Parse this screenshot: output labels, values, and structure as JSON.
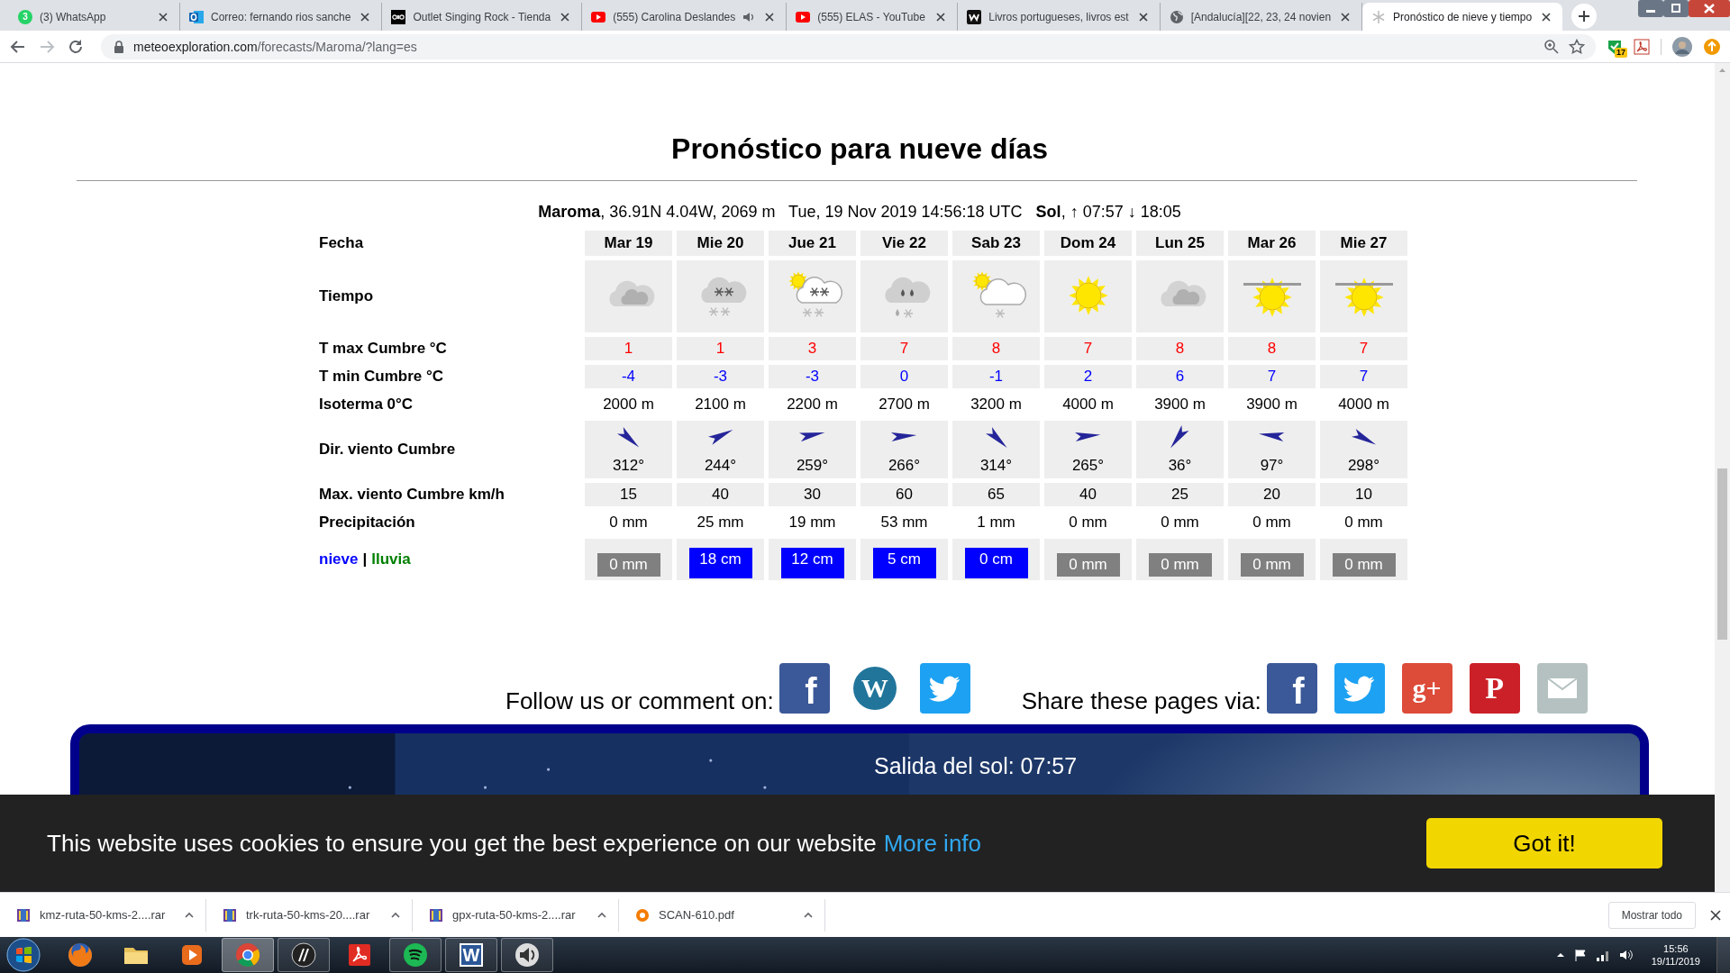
{
  "browser": {
    "tabs": [
      {
        "title": "(3) WhatsApp",
        "kind": "whatsapp",
        "glyph": "3",
        "selected": false,
        "audio": false
      },
      {
        "title": "Correo: fernando rios sanche",
        "kind": "outlook",
        "selected": false,
        "audio": false
      },
      {
        "title": "Outlet Singing Rock - Tienda",
        "kind": "dark-square",
        "selected": false,
        "audio": false
      },
      {
        "title": "(555) Carolina Deslandes",
        "kind": "youtube",
        "selected": false,
        "audio": true
      },
      {
        "title": "(555) ELAS - YouTube",
        "kind": "youtube",
        "selected": false,
        "audio": false
      },
      {
        "title": "Livros portugueses, livros est",
        "kind": "w-square",
        "selected": false,
        "audio": false
      },
      {
        "title": "[Andalucía][22, 23, 24 novien",
        "kind": "globe",
        "selected": false,
        "audio": false
      },
      {
        "title": "Pronóstico de nieve y tiempo",
        "kind": "snowflake",
        "selected": true,
        "audio": false
      }
    ],
    "url_host": "meteoexploration.com",
    "url_path": "/forecasts/Maroma/?lang=es",
    "extension_badge": "17"
  },
  "forecast": {
    "title": "Pronóstico para nueve días",
    "info": "**Maroma**, 36.91N 4.04W, 2069 m   Tue, 19 Nov 2019 14:56:18 UTC   **Sol**, ↑ 07:57 ↓ 18:05",
    "row_labels": [
      "Fecha",
      "Tiempo",
      "T max Cumbre °C",
      "T min Cumbre °C",
      "Isoterma 0°C",
      "Dir. viento Cumbre",
      "Max. viento Cumbre km/h",
      "Precipitación"
    ],
    "snow_label": "nieve",
    "separator": "|",
    "rain_label": "lluvia",
    "days": [
      {
        "date": "Mar 19",
        "kind": "cloud",
        "tmax": "1",
        "tmin": "-4",
        "isotherm": "2000 m",
        "wind_dir": "312°",
        "wind_max": "15",
        "precip": "0 mm",
        "snow": {
          "kind": "none",
          "text": "0 mm"
        }
      },
      {
        "date": "Mie 20",
        "kind": "snow-cloud",
        "tmax": "1",
        "tmin": "-3",
        "isotherm": "2100 m",
        "wind_dir": "244°",
        "wind_max": "40",
        "precip": "25 mm",
        "snow": {
          "kind": "snow",
          "text": "18 cm"
        }
      },
      {
        "date": "Jue 21",
        "kind": "sun-snow-cloud",
        "tmax": "3",
        "tmin": "-3",
        "isotherm": "2200 m",
        "wind_dir": "259°",
        "wind_max": "30",
        "precip": "19 mm",
        "snow": {
          "kind": "snow",
          "text": "12 cm"
        }
      },
      {
        "date": "Vie 22",
        "kind": "rain-snow-cloud",
        "tmax": "7",
        "tmin": "0",
        "isotherm": "2700 m",
        "wind_dir": "266°",
        "wind_max": "60",
        "precip": "53 mm",
        "snow": {
          "kind": "snow",
          "text": "5 cm"
        }
      },
      {
        "date": "Sab 23",
        "kind": "sun-cloud-snow",
        "tmax": "8",
        "tmin": "-1",
        "isotherm": "3200 m",
        "wind_dir": "314°",
        "wind_max": "65",
        "precip": "1 mm",
        "snow": {
          "kind": "snow",
          "text": "0 cm"
        }
      },
      {
        "date": "Dom 24",
        "kind": "sun",
        "tmax": "7",
        "tmin": "2",
        "isotherm": "4000 m",
        "wind_dir": "265°",
        "wind_max": "40",
        "precip": "0 mm",
        "snow": {
          "kind": "none",
          "text": "0 mm"
        }
      },
      {
        "date": "Lun 25",
        "kind": "cloud",
        "tmax": "8",
        "tmin": "6",
        "isotherm": "3900 m",
        "wind_dir": "36°",
        "wind_max": "25",
        "precip": "0 mm",
        "snow": {
          "kind": "none",
          "text": "0 mm"
        }
      },
      {
        "date": "Mar 26",
        "kind": "hazy-sun",
        "tmax": "8",
        "tmin": "7",
        "isotherm": "3900 m",
        "wind_dir": "97°",
        "wind_max": "20",
        "precip": "0 mm",
        "snow": {
          "kind": "none",
          "text": "0 mm"
        }
      },
      {
        "date": "Mie 27",
        "kind": "hazy-sun",
        "tmax": "7",
        "tmin": "7",
        "isotherm": "4000 m",
        "wind_dir": "298°",
        "wind_max": "10",
        "precip": "0 mm",
        "snow": {
          "kind": "none",
          "text": "0 mm"
        }
      }
    ]
  },
  "social": {
    "follow_label": "Follow us or comment on:",
    "follow": [
      {
        "kind": "facebook",
        "glyph": "f"
      },
      {
        "kind": "wordpress",
        "glyph": "W"
      },
      {
        "kind": "twitter"
      }
    ],
    "share_label": "Share these pages via:",
    "share": [
      {
        "kind": "facebook",
        "glyph": "f"
      },
      {
        "kind": "twitter"
      },
      {
        "kind": "google-plus",
        "glyph": "g+"
      },
      {
        "kind": "pinterest",
        "glyph": "P"
      },
      {
        "kind": "email"
      }
    ]
  },
  "banner": {
    "sunrise": "Salida del sol: 07:57"
  },
  "cookie": {
    "text": "This website uses cookies to ensure you get the best experience on our website",
    "link": "More info",
    "button": "Got it!"
  },
  "downloads": {
    "items": [
      {
        "name": "kmz-ruta-50-kms-2....rar",
        "kind": "rar"
      },
      {
        "name": "trk-ruta-50-kms-20....rar",
        "kind": "rar"
      },
      {
        "name": "gpx-ruta-50-kms-2....rar",
        "kind": "rar"
      },
      {
        "name": "SCAN-610.pdf",
        "kind": "pdf"
      }
    ],
    "show_all": "Mostrar todo"
  },
  "taskbar": {
    "apps": [
      {
        "kind": "firefox",
        "running": false,
        "selected": false
      },
      {
        "kind": "folder",
        "running": false,
        "selected": false
      },
      {
        "kind": "media",
        "running": false,
        "selected": false
      },
      {
        "kind": "chrome",
        "running": true,
        "selected": true
      },
      {
        "kind": "hp",
        "running": true,
        "selected": false
      },
      {
        "kind": "acrobat",
        "running": false,
        "selected": false
      },
      {
        "kind": "spotify",
        "running": true,
        "selected": false
      },
      {
        "kind": "word",
        "glyph": "W",
        "running": true,
        "selected": false
      },
      {
        "kind": "speaker",
        "running": true,
        "selected": false
      }
    ],
    "time": "15:56",
    "date": "19/11/2019"
  }
}
